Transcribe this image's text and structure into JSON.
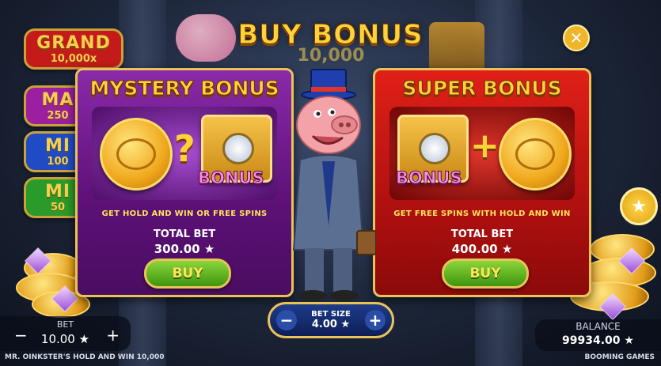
{
  "title": "BUY BONUS",
  "close_icon": "close-icon",
  "jackpots": [
    {
      "name": "GRAND",
      "value": "10,000x",
      "color": "#c41a1a"
    },
    {
      "name": "MA",
      "value": "250",
      "color": "#9b1fa0"
    },
    {
      "name": "MI",
      "value": "100",
      "color": "#1f4cc4"
    },
    {
      "name": "MI",
      "value": "50",
      "color": "#2a9a2a"
    }
  ],
  "background_jackpot_value": "10,000",
  "mystery": {
    "title": "MYSTERY BONUS",
    "art_symbol": "?",
    "bonus_tag": "BONUS",
    "description": "GET HOLD AND WIN OR FREE SPINS",
    "total_bet_label": "TOTAL BET",
    "total_bet_value": "300.00 ★",
    "buy_label": "BUY"
  },
  "super": {
    "title": "SUPER BONUS",
    "art_symbol": "+",
    "bonus_tag": "BONUS",
    "description": "GET FREE SPINS WITH HOLD AND WIN",
    "total_bet_label": "TOTAL BET",
    "total_bet_value": "400.00 ★",
    "buy_label": "BUY"
  },
  "bet_size": {
    "label": "BET SIZE",
    "value": "4.00 ★",
    "minus": "−",
    "plus": "+"
  },
  "bet": {
    "label": "BET",
    "value": "10.00 ★",
    "minus": "−",
    "plus": "+"
  },
  "balance": {
    "label": "BALANCE",
    "value": "99934.00 ★"
  },
  "footer_game_name": "MR. OINKSTER'S HOLD AND WIN 10,000",
  "footer_brand": "BOOMING GAMES",
  "colors": {
    "accent_gold": "#ffd23a",
    "mystery_panel": "#7a1f98",
    "super_panel": "#c81414",
    "buy_green": "#5cb31e"
  }
}
